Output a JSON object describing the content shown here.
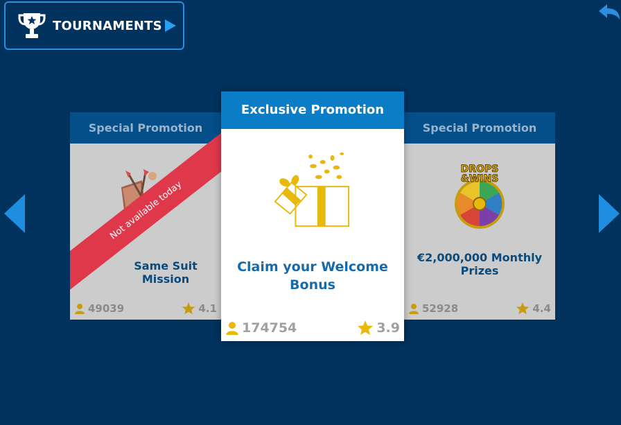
{
  "header": {
    "tournaments_label": "TOURNAMENTS"
  },
  "cards": {
    "left": {
      "header": "Special Promotion",
      "title": "Same Suit Mission",
      "ribbon": "Not available today",
      "players": "49039",
      "rating": "4.1"
    },
    "center": {
      "header": "Exclusive Promotion",
      "title_line1": "Claim your Welcome",
      "title_line2": "Bonus",
      "players": "174754",
      "rating": "3.9"
    },
    "right": {
      "header": "Special Promotion",
      "title_line1": "€2,000,000 Monthly",
      "title_line2": "Prizes",
      "logo_text_1": "DROPS",
      "logo_text_2": "&WINS",
      "players": "52928",
      "rating": "4.4"
    }
  },
  "colors": {
    "background": "#02325e",
    "accent": "#0b7cc6",
    "ribbon": "#e0384b",
    "gold": "#e8b90c"
  }
}
